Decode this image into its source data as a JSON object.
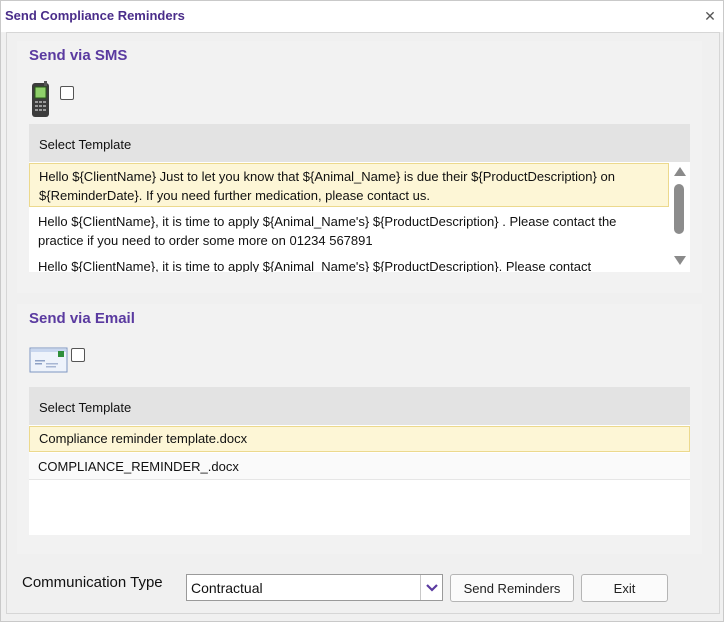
{
  "window": {
    "title": "Send Compliance Reminders"
  },
  "sms": {
    "heading": "Send via SMS",
    "grid_header": "Select Template",
    "templates": [
      "Hello ${ClientName} Just to let you know that ${Animal_Name} is due their ${ProductDescription} on ${ReminderDate}. If you need further medication, please contact us.",
      "Hello ${ClientName}, it is time to apply ${Animal_Name's} ${ProductDescription} . Please contact the practice if you need to order some more on 01234 567891",
      "Hello ${ClientName}, it is time to apply ${Animal_Name's} ${ProductDescription}. Please contact"
    ]
  },
  "email": {
    "heading": "Send via Email",
    "grid_header": "Select Template",
    "templates": [
      "Compliance reminder template.docx",
      "COMPLIANCE_REMINDER_.docx"
    ]
  },
  "footer": {
    "communication_type_label": "Communication Type",
    "communication_type_value": "Contractual",
    "send_label": "Send Reminders",
    "exit_label": "Exit"
  },
  "icons": {
    "close": "close-icon",
    "phone": "mobile-phone-icon",
    "email": "envelope-icon",
    "dropdown": "chevron-down-icon"
  },
  "colors": {
    "title": "#4a2d8a",
    "heading": "#5a3aa0",
    "selected_row": "#fdf6d6",
    "dropdown_chevron": "#5a3aa0"
  }
}
